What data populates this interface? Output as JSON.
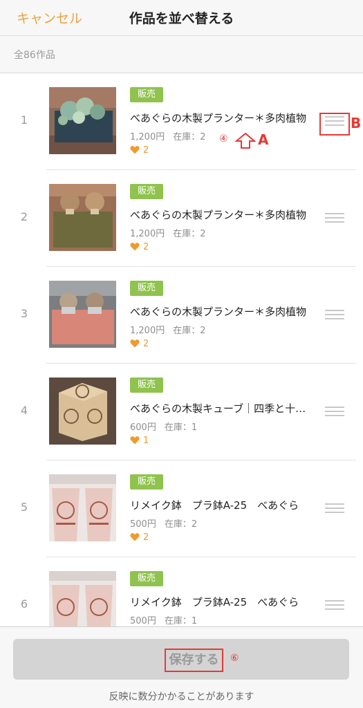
{
  "nav": {
    "cancel_label": "キャンセル",
    "title": "作品を並べ替える"
  },
  "summary": {
    "count_text": "全86作品"
  },
  "items": [
    {
      "rank": "1",
      "badge": "販売",
      "title": "べあぐらの木製プランター＊多肉植物",
      "price": "1,200円",
      "stock": "在庫：2",
      "likes": "2"
    },
    {
      "rank": "2",
      "badge": "販売",
      "title": "べあぐらの木製プランター＊多肉植物",
      "price": "1,200円",
      "stock": "在庫：2",
      "likes": "2"
    },
    {
      "rank": "3",
      "badge": "販売",
      "title": "べあぐらの木製プランター＊多肉植物",
      "price": "1,200円",
      "stock": "在庫：2",
      "likes": "2"
    },
    {
      "rank": "4",
      "badge": "販売",
      "title": "べあぐらの木製キューブ｜四季と十二支",
      "price": "600円",
      "stock": "在庫：1",
      "likes": "1"
    },
    {
      "rank": "5",
      "badge": "販売",
      "title": "リメイク鉢　プラ鉢A-25　べあぐら",
      "price": "500円",
      "stock": "在庫：2",
      "likes": "2"
    },
    {
      "rank": "6",
      "badge": "販売",
      "title": "リメイク鉢　プラ鉢A-25　べあぐら",
      "price": "500円",
      "stock": "在庫：1",
      "likes": ""
    }
  ],
  "annotations": {
    "circle_4": "④",
    "letter_a": "A",
    "letter_b": "B",
    "circle_6": "⑥"
  },
  "footer": {
    "save_label": "保存する",
    "note": "反映に数分かかることがあります"
  },
  "colors": {
    "accent": "#f0a13c",
    "badge_green": "#8fc34d",
    "heart": "#f09a2c",
    "annotation_red": "#e53935",
    "button_disabled": "#d4d4d4"
  }
}
